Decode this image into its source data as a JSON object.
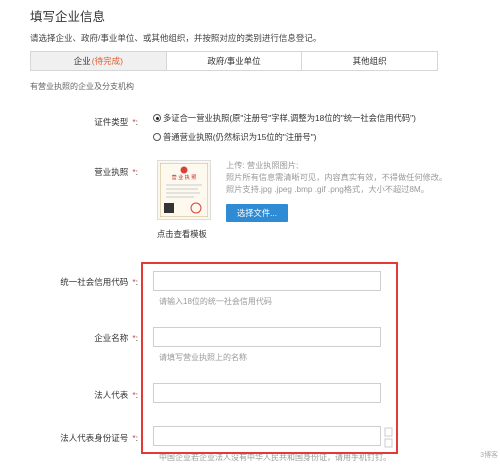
{
  "header": {
    "title": "填写企业信息",
    "subtitle": "请选择企业、政府/事业单位、或其他组织，并按照对应的类别进行信息登记。"
  },
  "tabs": [
    {
      "label": "企业",
      "status": "(待完成)"
    },
    {
      "label": "政府/事业单位",
      "status": ""
    },
    {
      "label": "其他组织",
      "status": ""
    }
  ],
  "section_note": "有营业执照的企业及分支机构",
  "required_mark": "*",
  "label_suffix": ":",
  "form": {
    "cert_type": {
      "label": "证件类型",
      "options": [
        "多证合一营业执照(原\"注册号\"字样,调整为18位的\"统一社会信用代码\")",
        "普通营业执照(仍然标识为15位的\"注册号\")"
      ],
      "selected_index": 0
    },
    "license": {
      "label": "营业执照",
      "view_template": "点击查看模板",
      "hint_lines": [
        "上传: 营业执照图片;",
        "照片所有信息需清晰可见，内容真实有效，不得做任何修改。",
        "照片支持.jpg .jpeg .bmp .gif .png格式，大小不超过8M。"
      ],
      "upload_button": "选择文件...",
      "thumb_title": "营 业 执 照"
    },
    "credit_code": {
      "label": "统一社会信用代码",
      "value": "",
      "hint": "请输入18位的统一社会信用代码"
    },
    "company_name": {
      "label": "企业名称",
      "value": "",
      "hint": "请填写营业执照上的名称"
    },
    "legal_rep": {
      "label": "法人代表",
      "value": ""
    },
    "legal_rep_id": {
      "label": "法人代表身份证号",
      "value": "",
      "hint": "中国企业若企业法人没有中华人民共和国身份证，请用手机钉钉。"
    }
  },
  "corner_text": "3博客",
  "colors": {
    "required": "#e03c3c",
    "pending": "#e25c2d",
    "button": "#2f8bd3",
    "highlight": "#e53935",
    "active_tab": "#f0f0f0"
  }
}
